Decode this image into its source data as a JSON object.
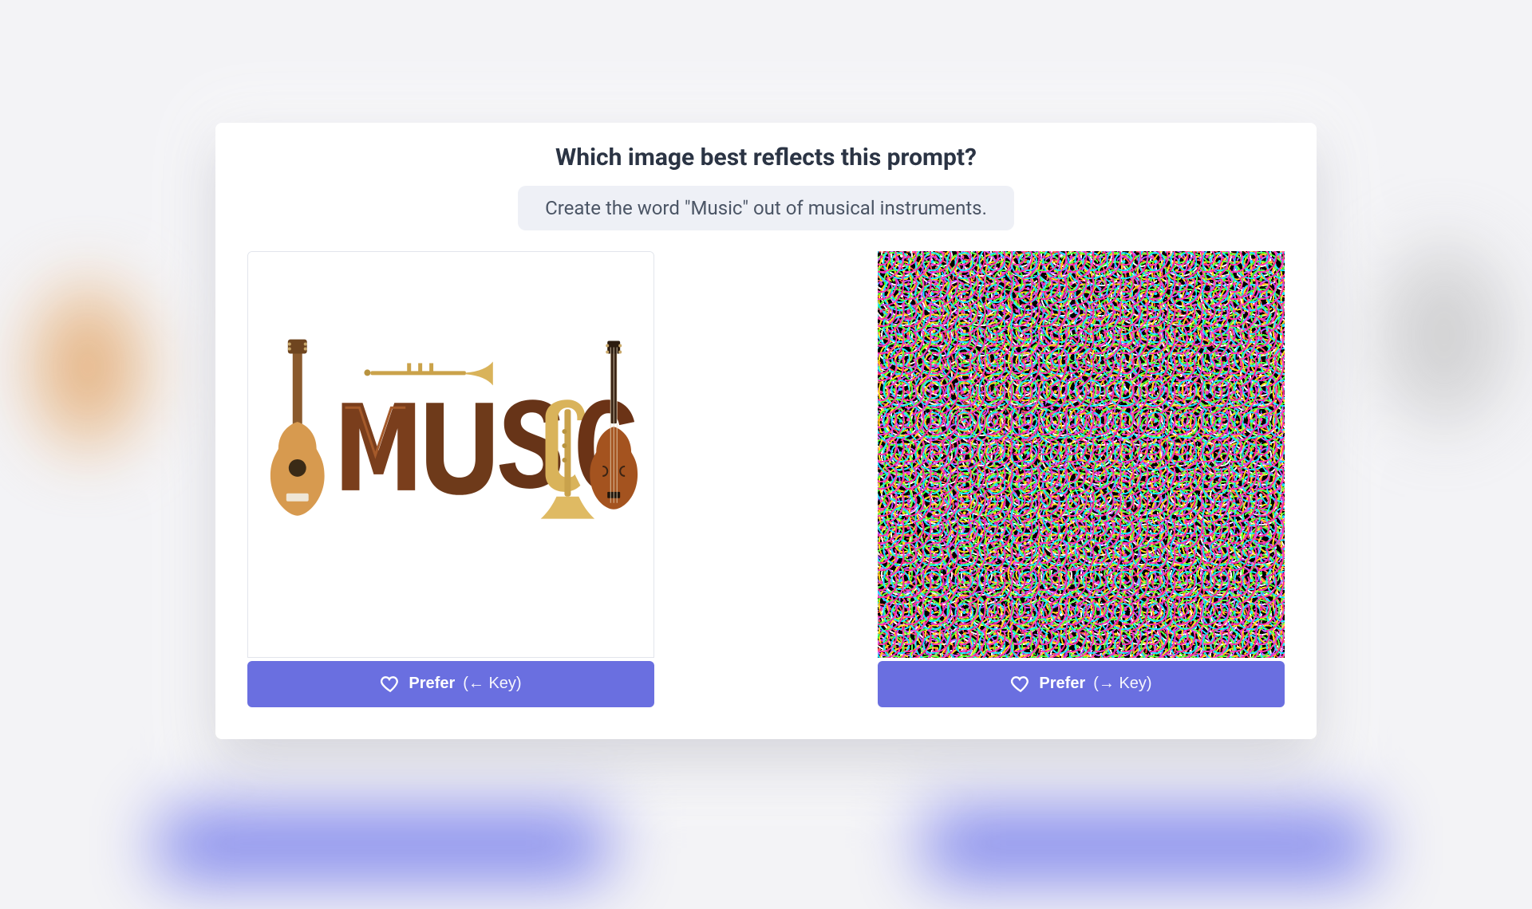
{
  "question": "Which image best reflects this prompt?",
  "prompt": "Create the word \"Music\" out of musical instruments.",
  "left": {
    "prefer_label": "Prefer",
    "key_hint": "(← Key)",
    "image_alt": "The word MUSIC rendered from musical instruments (guitar, trumpet, violin)"
  },
  "right": {
    "prefer_label": "Prefer",
    "key_hint": "(→ Key)",
    "image_alt": "Dense multicolored noise / static pattern"
  },
  "colors": {
    "accent": "#6a6fe0",
    "text": "#2b3444",
    "pill_bg": "#eef0f6"
  }
}
